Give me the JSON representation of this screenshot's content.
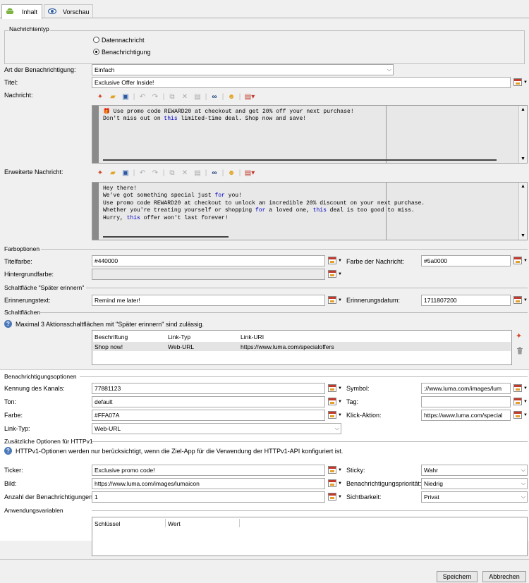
{
  "tabs": [
    {
      "label": "Inhalt",
      "icon": "android-icon"
    },
    {
      "label": "Vorschau",
      "icon": "eye-icon"
    }
  ],
  "nachrichtentyp": {
    "section": "Nachrichtentyp",
    "option1": "Datennachricht",
    "option2": "Benachrichtigung",
    "selected": "Benachrichtigung"
  },
  "labels": {
    "art": "Art der Benachrichtigung:",
    "titel": "Titel:",
    "nachricht": "Nachricht:",
    "erweitert": "Erweiterte Nachricht:",
    "titelfarbe": "Titelfarbe:",
    "farbe_nachricht": "Farbe der Nachricht:",
    "hintergrundfarbe": "Hintergrundfarbe:",
    "erinnerungstext": "Erinnerungstext:",
    "erinnerungsdatum": "Erinnerungsdatum:",
    "kennung": "Kennung des Kanals:",
    "ton": "Ton:",
    "farbe": "Farbe:",
    "linktyp": "Link-Typ:",
    "symbol": "Symbol:",
    "tag": "Tag:",
    "klick": "Klick-Aktion:",
    "ticker": "Ticker:",
    "bild": "Bild:",
    "anzahl": "Anzahl der Benachrichtigungen:",
    "sticky": "Sticky:",
    "prioritaet": "Benachrichtigungspriorität:",
    "sichtbarkeit": "Sichtbarkeit:"
  },
  "values": {
    "art": "Einfach",
    "titel": "Exclusive Offer Inside!",
    "titelfarbe": "#440000",
    "farbe_nachricht": "#5a0000",
    "hintergrundfarbe": "",
    "erinnerungstext": "Remind me later!",
    "erinnerungsdatum": "1711807200",
    "kennung": "77881123",
    "ton": "default",
    "farbe": "#FFA07A",
    "linktyp": "Web-URL",
    "symbol": "://www.luma.com/images/lum",
    "tag": "",
    "klick": "https://www.luma.com/special",
    "ticker": "Exclusive promo code!",
    "bild": "https://www.luma.com/images/lumaicon",
    "anzahl": "1",
    "sticky": "Wahr",
    "prioritaet": "Niedrig",
    "sichtbarkeit": "Privat"
  },
  "message_lines": [
    "🎁 Use promo code REWARD20 at checkout and get 20% off your next purchase!",
    "Don't miss out on this limited-time deal. Shop now and save!"
  ],
  "extended_lines": [
    "Hey there!",
    "We've got something special just for you!",
    "Use promo code REWARD20 at checkout to unlock an incredible 20% discount on your next purchase.",
    "Whether you're treating yourself or shopping for a loved one, this deal is too good to miss.",
    "Hurry, this offer won't last forever!"
  ],
  "sections": {
    "farboptionen": "Farboptionen",
    "spaeter": "Schaltfläche \"Später erinnern\"",
    "schaltflaechen": "Schaltflächen",
    "benachrichtigungsoptionen": "Benachrichtigungsoptionen",
    "httpv1": "Zusätzliche Optionen für HTTPv1",
    "anwendungsvariablen": "Anwendungsvariablen"
  },
  "notes": {
    "schaltflaechen": "Maximal 3 Aktionsschaltflächen mit \"Später erinnern\" sind zulässig.",
    "httpv1": "HTTPv1-Optionen werden nur berücksichtigt, wenn die Ziel-App für die Verwendung der HTTPv1-API konfiguriert ist."
  },
  "buttons_table": {
    "headers": [
      "Beschriftung",
      "Link-Typ",
      "Link-URI"
    ],
    "rows": [
      [
        "Shop now!",
        "Web-URL",
        "https://www.luma.com/specialoffers"
      ]
    ]
  },
  "vars_table": {
    "headers": [
      "Schlüssel",
      "Wert"
    ]
  },
  "footer": {
    "save": "Speichern",
    "cancel": "Abbrechen"
  }
}
